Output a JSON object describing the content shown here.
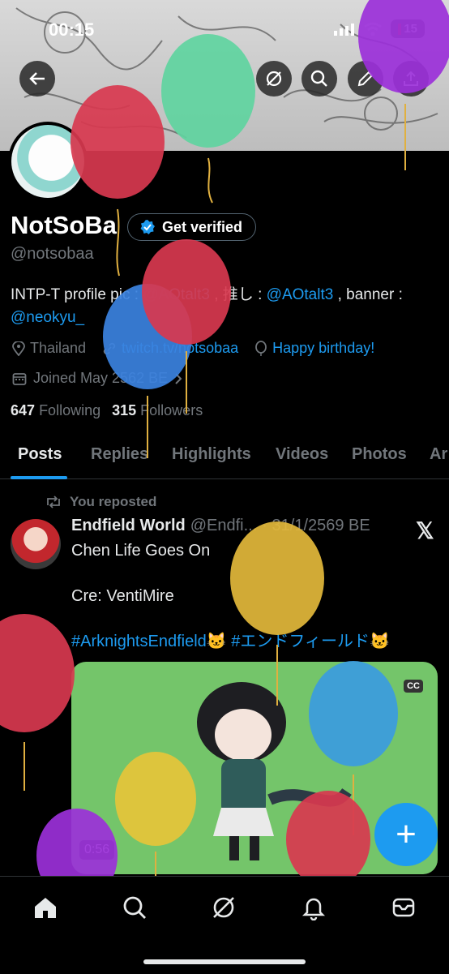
{
  "status_bar": {
    "time": "00:15",
    "battery": "15"
  },
  "header": {
    "back_icon": "arrow-left-icon",
    "action_icons": [
      "grok-icon",
      "search-icon",
      "edit-icon",
      "share-icon"
    ]
  },
  "profile": {
    "name": "NotSoBa",
    "verify_label": "Get verified",
    "handle": "@notsobaa",
    "bio_part1": "INTP-T profile pic : ",
    "bio_mention1": "@AOtalt3",
    "bio_part2": " , 推し : ",
    "bio_mention2": "@AOtalt3",
    "bio_part3": " , banner : ",
    "bio_mention3": "@neokyu_",
    "location": "Thailand",
    "website": "twitch.tv/notsobaa",
    "birthday": "Happy birthday!",
    "joined": "Joined May 2562 BE",
    "following_count": "647",
    "following_label": "Following",
    "followers_count": "315",
    "followers_label": "Followers"
  },
  "tabs": [
    "Posts",
    "Replies",
    "Highlights",
    "Videos",
    "Photos",
    "Ar"
  ],
  "tweet": {
    "repost_label": "You reposted",
    "author": "Endfield World",
    "handle": "@Endfi...",
    "date": "· 31/1/2569 BE",
    "text": "Chen Life Goes On\n\nCre: VentiMire\n\n",
    "hashtag1": "#ArknightsEndfield🐱",
    "hashtag2": "#エンドフィールド🐱",
    "cc_label": "CC",
    "duration": "0:56"
  },
  "fab_label": "+",
  "nav": [
    "home-icon",
    "search-icon",
    "grok-icon",
    "notifications-icon",
    "messages-icon"
  ],
  "colors": {
    "accent": "#1d9bf0",
    "background": "#000000",
    "muted": "#71767b"
  }
}
